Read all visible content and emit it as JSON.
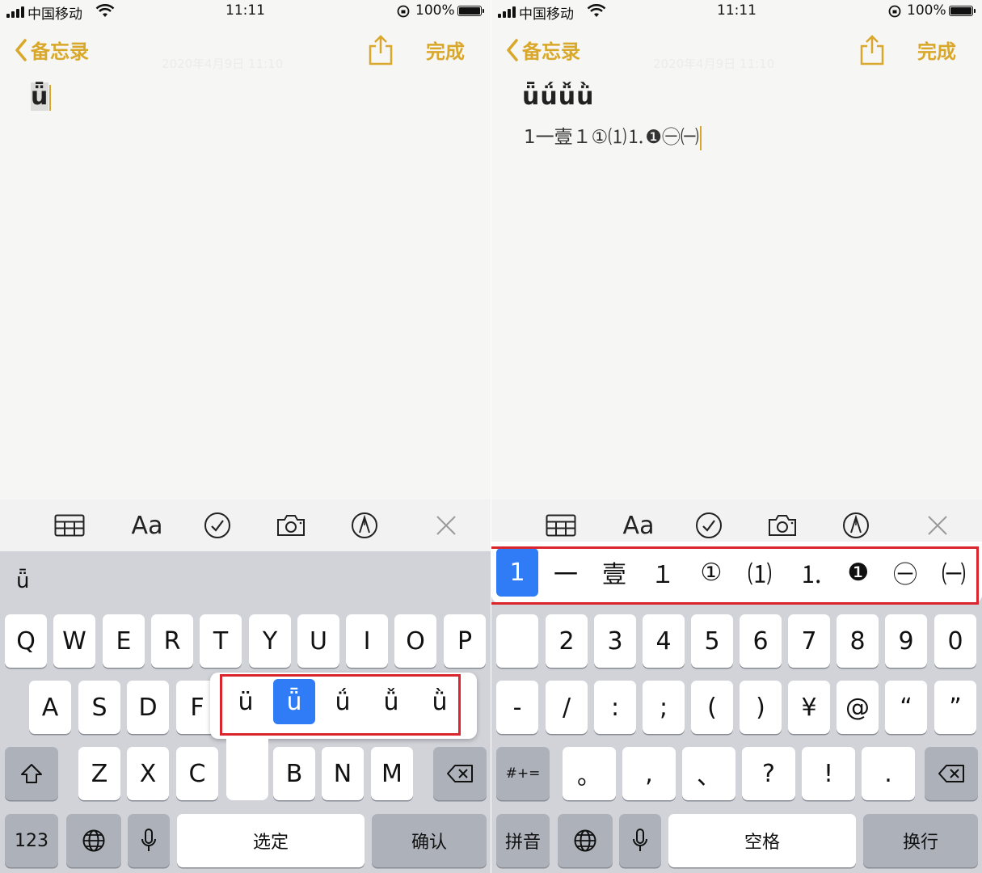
{
  "status": {
    "carrier": "中国移动",
    "time": "11:11",
    "battery": "100%"
  },
  "nav": {
    "back_label": "备忘录",
    "done_label": "完成"
  },
  "faded_date": "2020年4月9日 11:10",
  "left_note": {
    "text": "ǖ"
  },
  "right_note": {
    "title": "ǖǘǚǜ",
    "line": "1一壹１①⑴⒈❶㊀㈠"
  },
  "toolbar": {
    "format_label": "Aa"
  },
  "left_keyboard": {
    "composing": "ǖ",
    "row1": [
      "Q",
      "W",
      "E",
      "R",
      "T",
      "Y",
      "U",
      "I",
      "O",
      "P"
    ],
    "row2": [
      "A",
      "S",
      "D",
      "F"
    ],
    "row3": [
      "Z",
      "X",
      "C",
      "B",
      "N",
      "M"
    ],
    "accents": [
      "ü",
      "ǖ",
      "ǘ",
      "ǚ",
      "ǜ"
    ],
    "selected_accent_index": 1,
    "num_label": "123",
    "space_label": "选定",
    "return_label": "确认"
  },
  "right_keyboard": {
    "candidates": [
      "1",
      "一",
      "壹",
      "１",
      "①",
      "⑴",
      "⒈",
      "❶",
      "㊀",
      "㈠"
    ],
    "selected_candidate_index": 0,
    "row1": [
      "2",
      "3",
      "4",
      "5",
      "6",
      "7",
      "8",
      "9",
      "0"
    ],
    "row2": [
      "-",
      "/",
      ":",
      ";",
      "(",
      ")",
      "¥",
      "@",
      "“",
      "”"
    ],
    "row3": [
      "。",
      ",",
      "、",
      "?",
      "!",
      "."
    ],
    "symbols_label": "#+=",
    "pinyin_label": "拼音",
    "space_label": "空格",
    "return_label": "换行"
  },
  "colors": {
    "accent": "#d9a72a",
    "selection_blue": "#2f7cf6",
    "highlight_red": "#d9252b",
    "keyboard_bg": "#d1d3d9"
  }
}
